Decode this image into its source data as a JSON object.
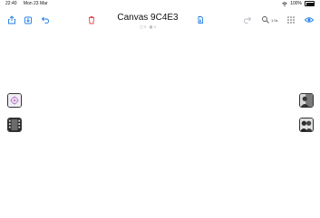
{
  "status_bar": {
    "time": "22:40",
    "date": "Mon 23 Mar",
    "battery_percent": "100%"
  },
  "toolbar": {
    "share_icon": "share-icon",
    "import_icon": "import-icon",
    "undo_icon": "undo-icon",
    "delete_icon": "trash-icon",
    "export_icon": "export-icon",
    "redo_icon": "redo-icon",
    "zoom_icon": "magnifier-icon",
    "zoom_label": "1.0x",
    "grid_icon": "grid-icon",
    "preview_icon": "eye-icon",
    "accent_color": "#1e7ee6",
    "delete_color": "#e24a4a"
  },
  "document": {
    "title": "Canvas 9C4E3",
    "meta_first": "0",
    "meta_second": "4"
  },
  "canvas_items": [
    {
      "name": "tiger-thumbnail"
    },
    {
      "name": "film-thumbnail"
    },
    {
      "name": "photo-thumbnail-1"
    },
    {
      "name": "photo-thumbnail-2"
    }
  ]
}
